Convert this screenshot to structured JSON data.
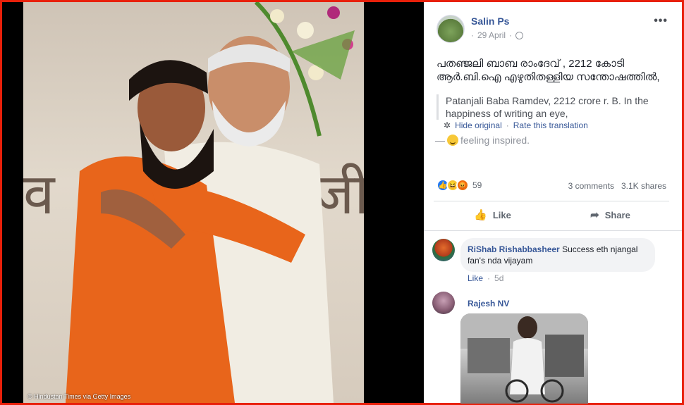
{
  "photo": {
    "credit": "© Hindustan Times via Getty Images"
  },
  "post": {
    "author": "Salin Ps",
    "date": "29 April",
    "text": "പതഞ്ജലി ബാബ രാംദേവ് , 2212 കോടി ആർ.ബി.ഐ എഴുതിതള്ളിയ സന്തോഷത്തിൽ,",
    "translation": "Patanjali Baba Ramdev, 2212 crore r. B. In the happiness of writing an eye,",
    "hide_original": "Hide original",
    "rate_translation": "Rate this translation",
    "feeling": "feeling inspired.",
    "reaction_count": "59",
    "comments_count": "3 comments",
    "shares_count": "3.1K shares",
    "like_label": "Like",
    "share_label": "Share"
  },
  "comments": [
    {
      "name": "RiShab Rishabbasheer",
      "text": "Success eth njangal fan's nda vijayam",
      "like": "Like",
      "time": "5d"
    },
    {
      "name": "Rajesh NV"
    }
  ]
}
